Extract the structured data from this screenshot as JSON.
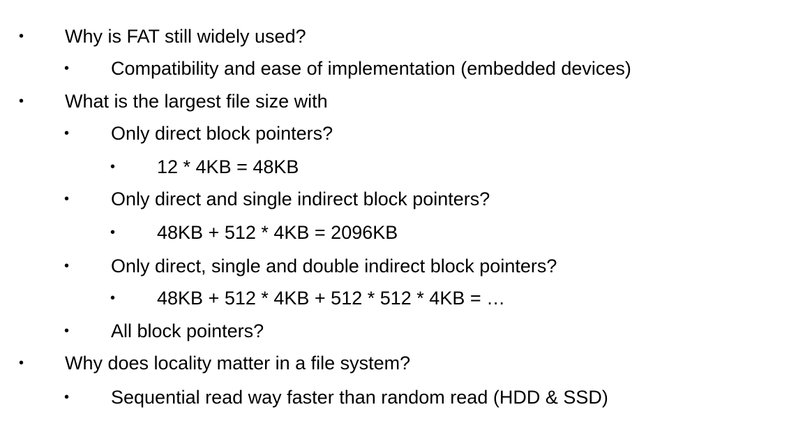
{
  "bullet_char": "•",
  "items": [
    {
      "level": 1,
      "text": "Why is FAT still widely used?"
    },
    {
      "level": 2,
      "text": "Compatibility and ease of implementation (embedded devices)"
    },
    {
      "level": 1,
      "text": "What is the largest file size with"
    },
    {
      "level": 2,
      "text": "Only direct block pointers?"
    },
    {
      "level": 3,
      "text": "12 * 4KB = 48KB"
    },
    {
      "level": 2,
      "text": "Only direct and single indirect block pointers?"
    },
    {
      "level": 3,
      "text": "48KB + 512 * 4KB = 2096KB"
    },
    {
      "level": 2,
      "text": "Only direct, single and double indirect block pointers?"
    },
    {
      "level": 3,
      "text": "48KB + 512 * 4KB + 512 * 512 * 4KB = …"
    },
    {
      "level": 2,
      "text": "All block pointers?"
    },
    {
      "level": 1,
      "text": "Why does locality matter in a file system?"
    },
    {
      "level": 2,
      "text": "Sequential read way faster than random read (HDD & SSD)"
    }
  ]
}
